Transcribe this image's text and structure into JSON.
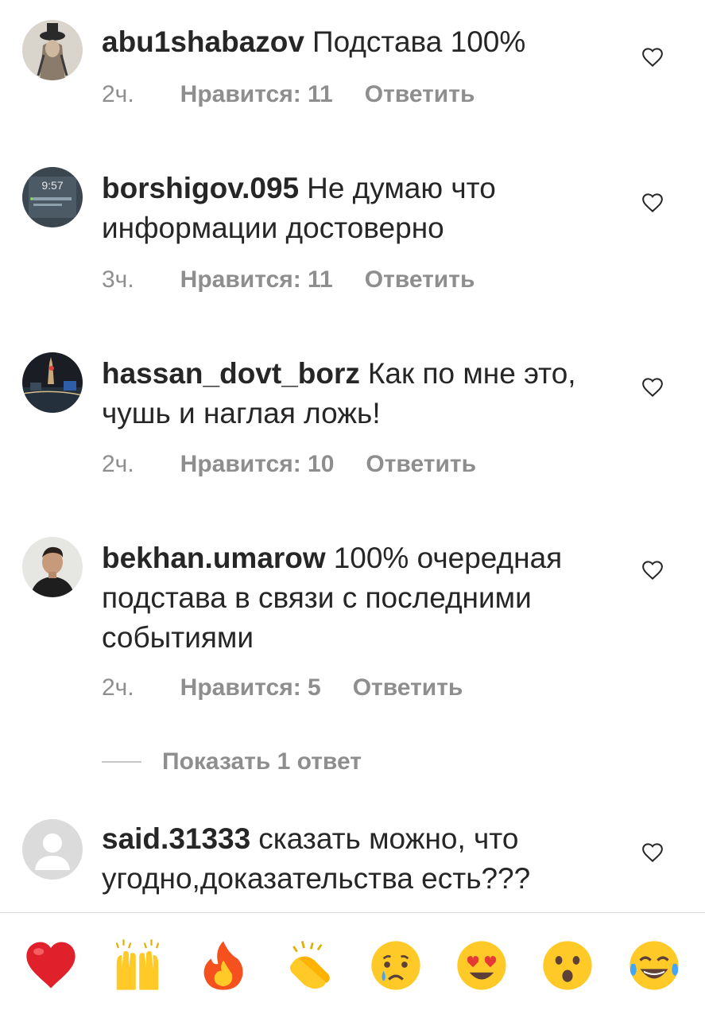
{
  "comments": [
    {
      "username": "abu1shabazov",
      "text": "Подстава 100%",
      "time": "2ч.",
      "likes": "Нравится: 11",
      "reply": "Ответить"
    },
    {
      "username": "borshigov.095",
      "text": "Не думаю что информации достоверно",
      "time": "3ч.",
      "likes": "Нравится: 11",
      "reply": "Ответить",
      "avatar_text": "9:57"
    },
    {
      "username": "hassan_dovt_borz",
      "text": "Как по мне это, чушь и наглая ложь!",
      "time": "2ч.",
      "likes": "Нравится: 10",
      "reply": "Ответить"
    },
    {
      "username": "bekhan.umarow",
      "text": "100% очередная подстава в связи с последними событиями",
      "time": "2ч.",
      "likes": "Нравится: 5",
      "reply": "Ответить"
    },
    {
      "username": "said.31333",
      "text": "сказать можно, что угодно,доказательства есть???"
    }
  ],
  "show_replies": "Показать 1 ответ",
  "emoji_bar": [
    "heart-emoji",
    "raised-hands-emoji",
    "fire-emoji",
    "clapping-hands-emoji",
    "crying-face-emoji",
    "heart-eyes-emoji",
    "surprised-face-emoji",
    "tears-of-joy-emoji"
  ],
  "colors": {
    "text": "#262626",
    "secondary": "#8e8e8e",
    "heart_outline": "#262626"
  }
}
